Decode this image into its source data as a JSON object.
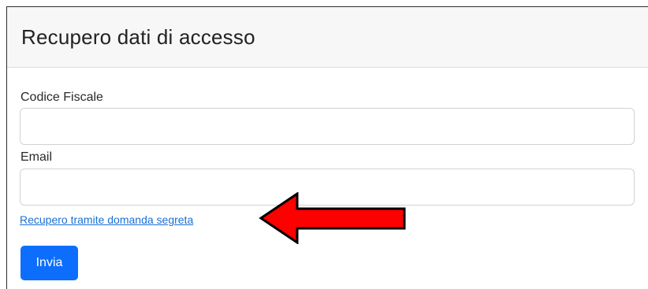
{
  "card": {
    "title": "Recupero dati di accesso"
  },
  "form": {
    "codice_fiscale": {
      "label": "Codice Fiscale",
      "value": "",
      "placeholder": ""
    },
    "email": {
      "label": "Email",
      "value": "",
      "placeholder": ""
    },
    "recovery_link": "Recupero tramite domanda segreta",
    "submit_label": "Invia"
  },
  "annotation": {
    "arrow_icon": "red-left-arrow-icon",
    "arrow_color": "#ff0000"
  },
  "colors": {
    "primary": "#0d6efd",
    "link": "#1a6fd6",
    "header_bg": "#f7f7f7"
  }
}
